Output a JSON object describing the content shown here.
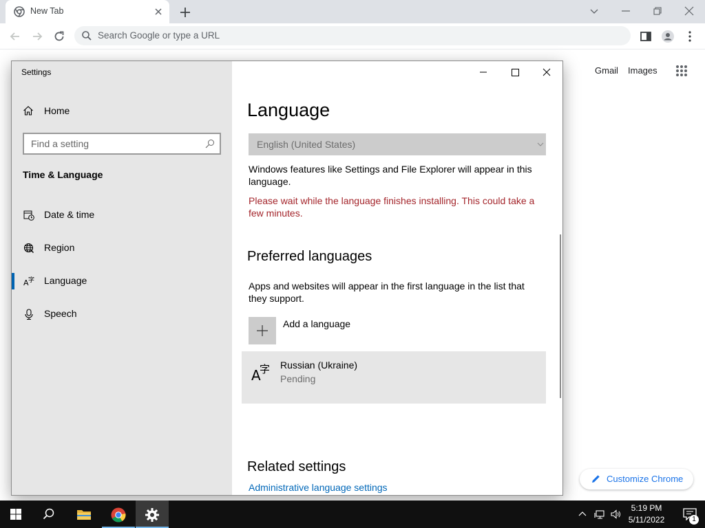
{
  "browser": {
    "tab_title": "New Tab",
    "omnibox_placeholder": "Search Google or type a URL"
  },
  "google": {
    "gmail_label": "Gmail",
    "images_label": "Images",
    "customize_label": "Customize Chrome"
  },
  "settings": {
    "window_title": "Settings",
    "home_label": "Home",
    "search_placeholder": "Find a setting",
    "section_title": "Time & Language",
    "nav_items": [
      {
        "label": "Date & time",
        "icon": "calendar-clock-icon"
      },
      {
        "label": "Region",
        "icon": "globe-icon"
      },
      {
        "label": "Language",
        "icon": "language-icon",
        "selected": true
      },
      {
        "label": "Speech",
        "icon": "microphone-icon"
      }
    ],
    "page_title": "Language",
    "display_language": "English (United States)",
    "display_language_desc": "Windows features like Settings and File Explorer will appear in this language.",
    "install_warning": "Please wait while the language finishes installing. This could take a few minutes.",
    "preferred_title": "Preferred languages",
    "preferred_desc": "Apps and websites will appear in the first language in the list that they support.",
    "add_language_label": "Add a language",
    "languages": [
      {
        "name": "Russian (Ukraine)",
        "status": "Pending"
      }
    ],
    "related_title": "Related settings",
    "admin_link": "Administrative language settings"
  },
  "taskbar": {
    "time": "5:19 PM",
    "date": "5/11/2022",
    "notification_count": "1"
  },
  "colors": {
    "accent": "#0063b1",
    "warning": "#a4262c",
    "link": "#0067b8",
    "chrome_blue": "#1a73e8"
  }
}
